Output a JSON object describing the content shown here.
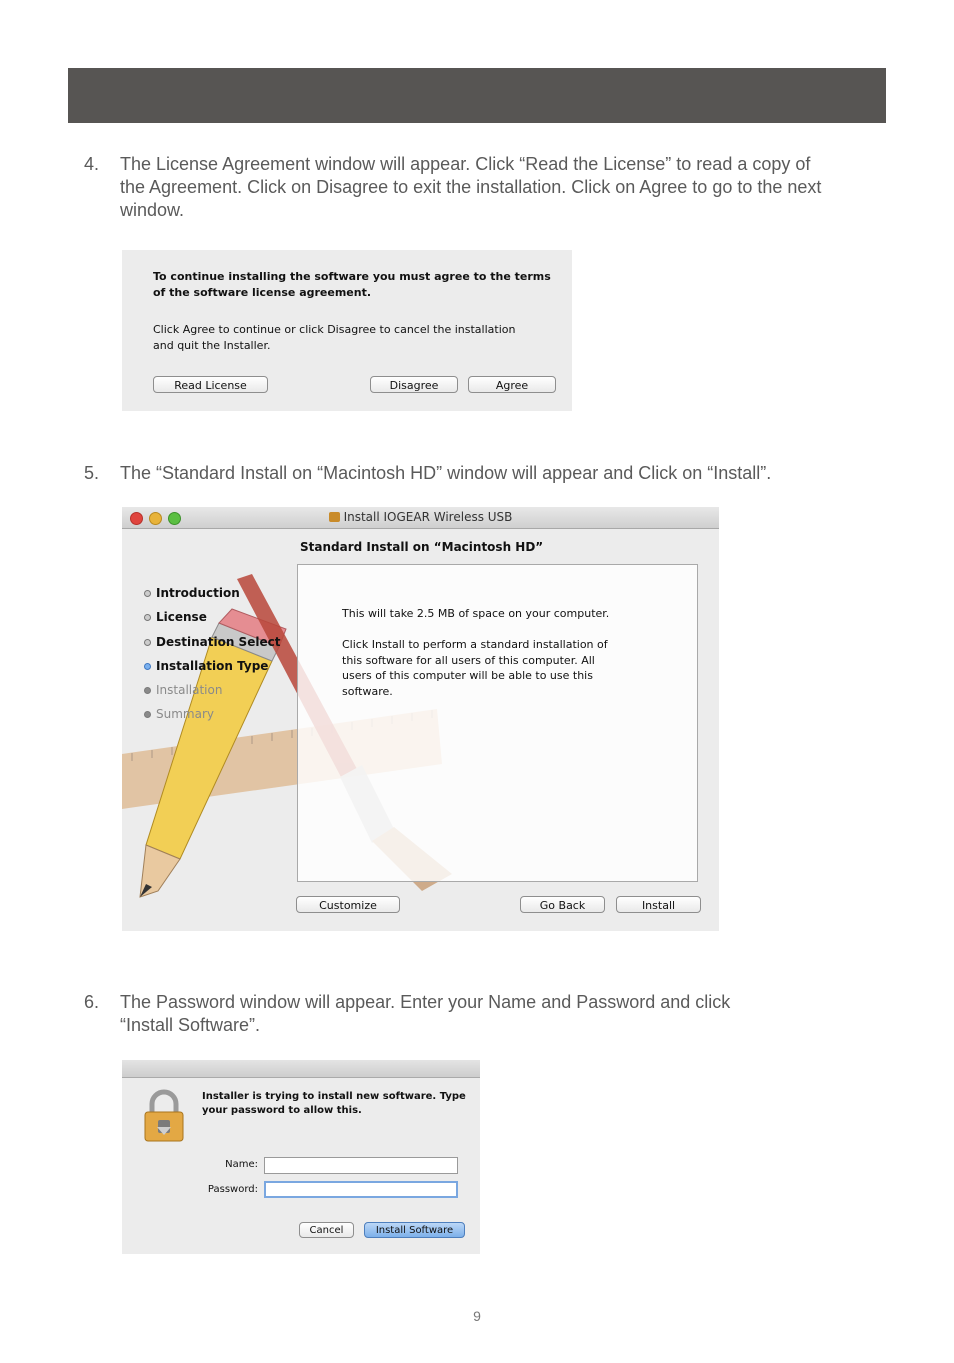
{
  "steps": [
    {
      "number": "4.",
      "lines": [
        "The License Agreement window will appear.  Click “Read the License” to read a copy of",
        "the Agreement.  Click on Disagree to exit the installation.  Click on Agree to go to the next",
        "window."
      ]
    },
    {
      "number": "5.",
      "lines": [
        "The “Standard Install on “Macintosh HD” window will appear and Click on “Install”."
      ]
    },
    {
      "number": "6.",
      "lines": [
        "The Password window will appear.  Enter your Name and Password and click",
        "“Install Software”."
      ]
    }
  ],
  "license_dialog": {
    "heading_lines": [
      "To continue installing the software you must agree to the terms",
      "of the software license agreement."
    ],
    "body_lines": [
      "Click Agree to continue or click Disagree to cancel the installation",
      "and quit the Installer."
    ],
    "read_license": "Read License",
    "disagree": "Disagree",
    "agree": "Agree"
  },
  "installer_window": {
    "title": "Install IOGEAR Wireless USB",
    "heading": "Standard Install on “Macintosh HD”",
    "sidebar": [
      "Introduction",
      "License",
      "Destination Select",
      "Installation Type",
      "Installation",
      "Summary"
    ],
    "space_text": "This will take 2.5 MB of space on your computer.",
    "body_lines": [
      "Click Install to perform a standard installation of",
      "this software for all users of this computer. All",
      "users of this computer will be able to use this",
      "software."
    ],
    "customize": "Customize",
    "go_back": "Go Back",
    "install": "Install"
  },
  "password_dialog": {
    "message_lines": [
      "Installer is trying to install new software. Type",
      "your password to allow this."
    ],
    "name_label": "Name:",
    "password_label": "Password:",
    "name_value": "",
    "password_value": "",
    "cancel": "Cancel",
    "install_software": "Install Software"
  },
  "page_number": "9",
  "colors": {
    "header_bar": "#575553",
    "text": "#5a5a5a"
  }
}
